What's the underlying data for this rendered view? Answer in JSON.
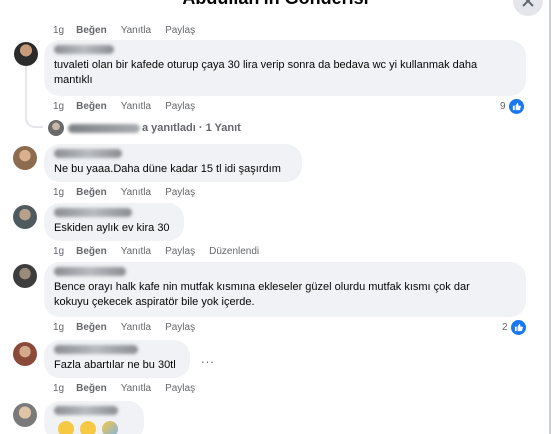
{
  "header": {
    "title": "Abdullah'ın Gönderisi"
  },
  "actions": {
    "like": "Beğen",
    "reply": "Yanıtla",
    "share": "Paylaş",
    "edited": "Düzenlendi"
  },
  "top_row": {
    "time": "1g"
  },
  "comments": [
    {
      "time": "1g",
      "text_line1": "tuvaleti olan bir kafede oturup çaya 30 lira verip sonra da bedava wc yi kullanmak daha",
      "text_line2": "mantıklı",
      "reactions": "9",
      "reaction_icon": "like-icon"
    },
    {
      "time": "1g",
      "text_line1": "Ne bu yaaa.Daha düne kadar 15 tl idi şaşırdım"
    },
    {
      "time": "1g",
      "text_line1": "Eskiden aylık ev kira 30"
    },
    {
      "time": "1g",
      "text_line1": "Bence orayı halk kafe nin mutfak kısmına ekleseler güzel olurdu mutfak kısmı çok dar",
      "text_line2": "kokuyu çekecek aspiratör bile yok içerde.",
      "reactions": "2",
      "reaction_icon": "like-icon"
    },
    {
      "time": "1g",
      "text_line1": "Fazla abartılar ne bu 30tl"
    }
  ],
  "replies_link": {
    "text": "a yanıtladı · 1 Yanıt"
  },
  "more_menu": "...",
  "colors": {
    "accent": "#1877f2",
    "bubble": "#f0f2f5",
    "meta": "#65676b"
  }
}
